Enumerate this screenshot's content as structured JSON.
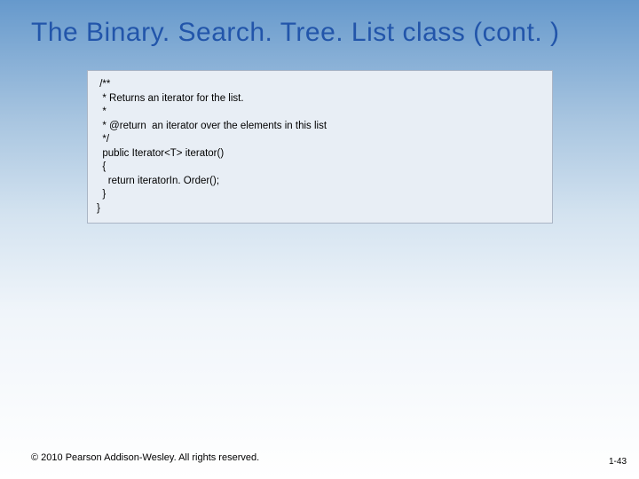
{
  "title": "The Binary. Search. Tree. List class (cont. )",
  "code": {
    "l0": " /**",
    "l1": "  * Returns an iterator for the list.",
    "l2": "  *",
    "l3": "  * @return  an iterator over the elements in this list",
    "l4": "  */",
    "l5": "  public Iterator<T> iterator()",
    "l6": "  {",
    "l7": "    return iteratorIn. Order();",
    "l8": "  }",
    "l9": "}"
  },
  "footer": "© 2010 Pearson Addison-Wesley. All rights reserved.",
  "page_num": "1-43"
}
